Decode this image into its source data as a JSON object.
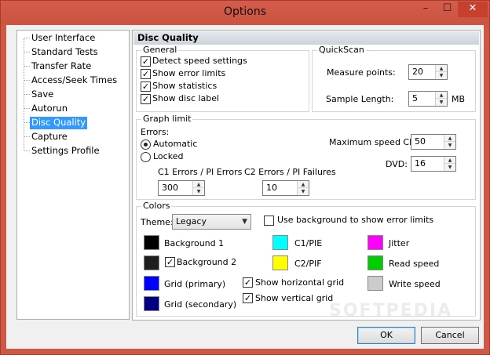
{
  "window": {
    "title": "Options",
    "minimize": "–",
    "maximize": "☐",
    "close": "✕"
  },
  "sidebar": {
    "items": [
      {
        "label": "User Interface",
        "selected": false
      },
      {
        "label": "Standard Tests",
        "selected": false
      },
      {
        "label": "Transfer Rate",
        "selected": false
      },
      {
        "label": "Access/Seek Times",
        "selected": false
      },
      {
        "label": "Save",
        "selected": false
      },
      {
        "label": "Autorun",
        "selected": false
      },
      {
        "label": "Disc Quality",
        "selected": true
      },
      {
        "label": "Capture",
        "selected": false
      },
      {
        "label": "Settings Profile",
        "selected": false
      }
    ]
  },
  "panel": {
    "title": "Disc Quality",
    "general": {
      "title": "General",
      "options": [
        {
          "label": "Detect speed settings",
          "checked": true
        },
        {
          "label": "Show error limits",
          "checked": true
        },
        {
          "label": "Show statistics",
          "checked": true
        },
        {
          "label": "Show disc label",
          "checked": true
        }
      ]
    },
    "quickscan": {
      "title": "QuickScan",
      "measure_points_label": "Measure points:",
      "measure_points_value": "20",
      "sample_length_label": "Sample Length:",
      "sample_length_value": "5",
      "sample_length_unit": "MB"
    },
    "graph_limit": {
      "title": "Graph limit",
      "errors_label": "Errors:",
      "automatic_label": "Automatic",
      "locked_label": "Locked",
      "errors_mode": "Automatic",
      "c1_label": "C1 Errors / PI Errors",
      "c1_value": "300",
      "c2_label": "C2 Errors / PI Failures",
      "c2_value": "10",
      "max_speed_cd_label": "Maximum speed CD:",
      "max_speed_cd_value": "50",
      "dvd_label": "DVD:",
      "dvd_value": "16"
    },
    "colors": {
      "title": "Colors",
      "theme_label": "Theme:",
      "theme_value": "Legacy",
      "use_bg_label": "Use background to show error limits",
      "use_bg_checked": false,
      "background1_label": "Background 1",
      "background1_color": "#000000",
      "background2_label": "Background 2",
      "background2_color": "#1e1e1e",
      "background2_checked": true,
      "grid_primary_label": "Grid (primary)",
      "grid_primary_color": "#0000ff",
      "grid_secondary_label": "Grid (secondary)",
      "grid_secondary_color": "#000080",
      "c1pie_label": "C1/PIE",
      "c1pie_color": "#00ffff",
      "c2pif_label": "C2/PIF",
      "c2pif_color": "#ffff00",
      "show_hgrid_label": "Show horizontal grid",
      "show_hgrid_checked": true,
      "show_vgrid_label": "Show vertical grid",
      "show_vgrid_checked": true,
      "jitter_label": "Jitter",
      "jitter_color": "#ff00ff",
      "read_speed_label": "Read speed",
      "read_speed_color": "#00cc00",
      "write_speed_label": "Write speed",
      "write_speed_color": "#cccccc"
    }
  },
  "footer": {
    "ok_label": "OK",
    "cancel_label": "Cancel"
  },
  "watermark": "SOFTPEDIA"
}
